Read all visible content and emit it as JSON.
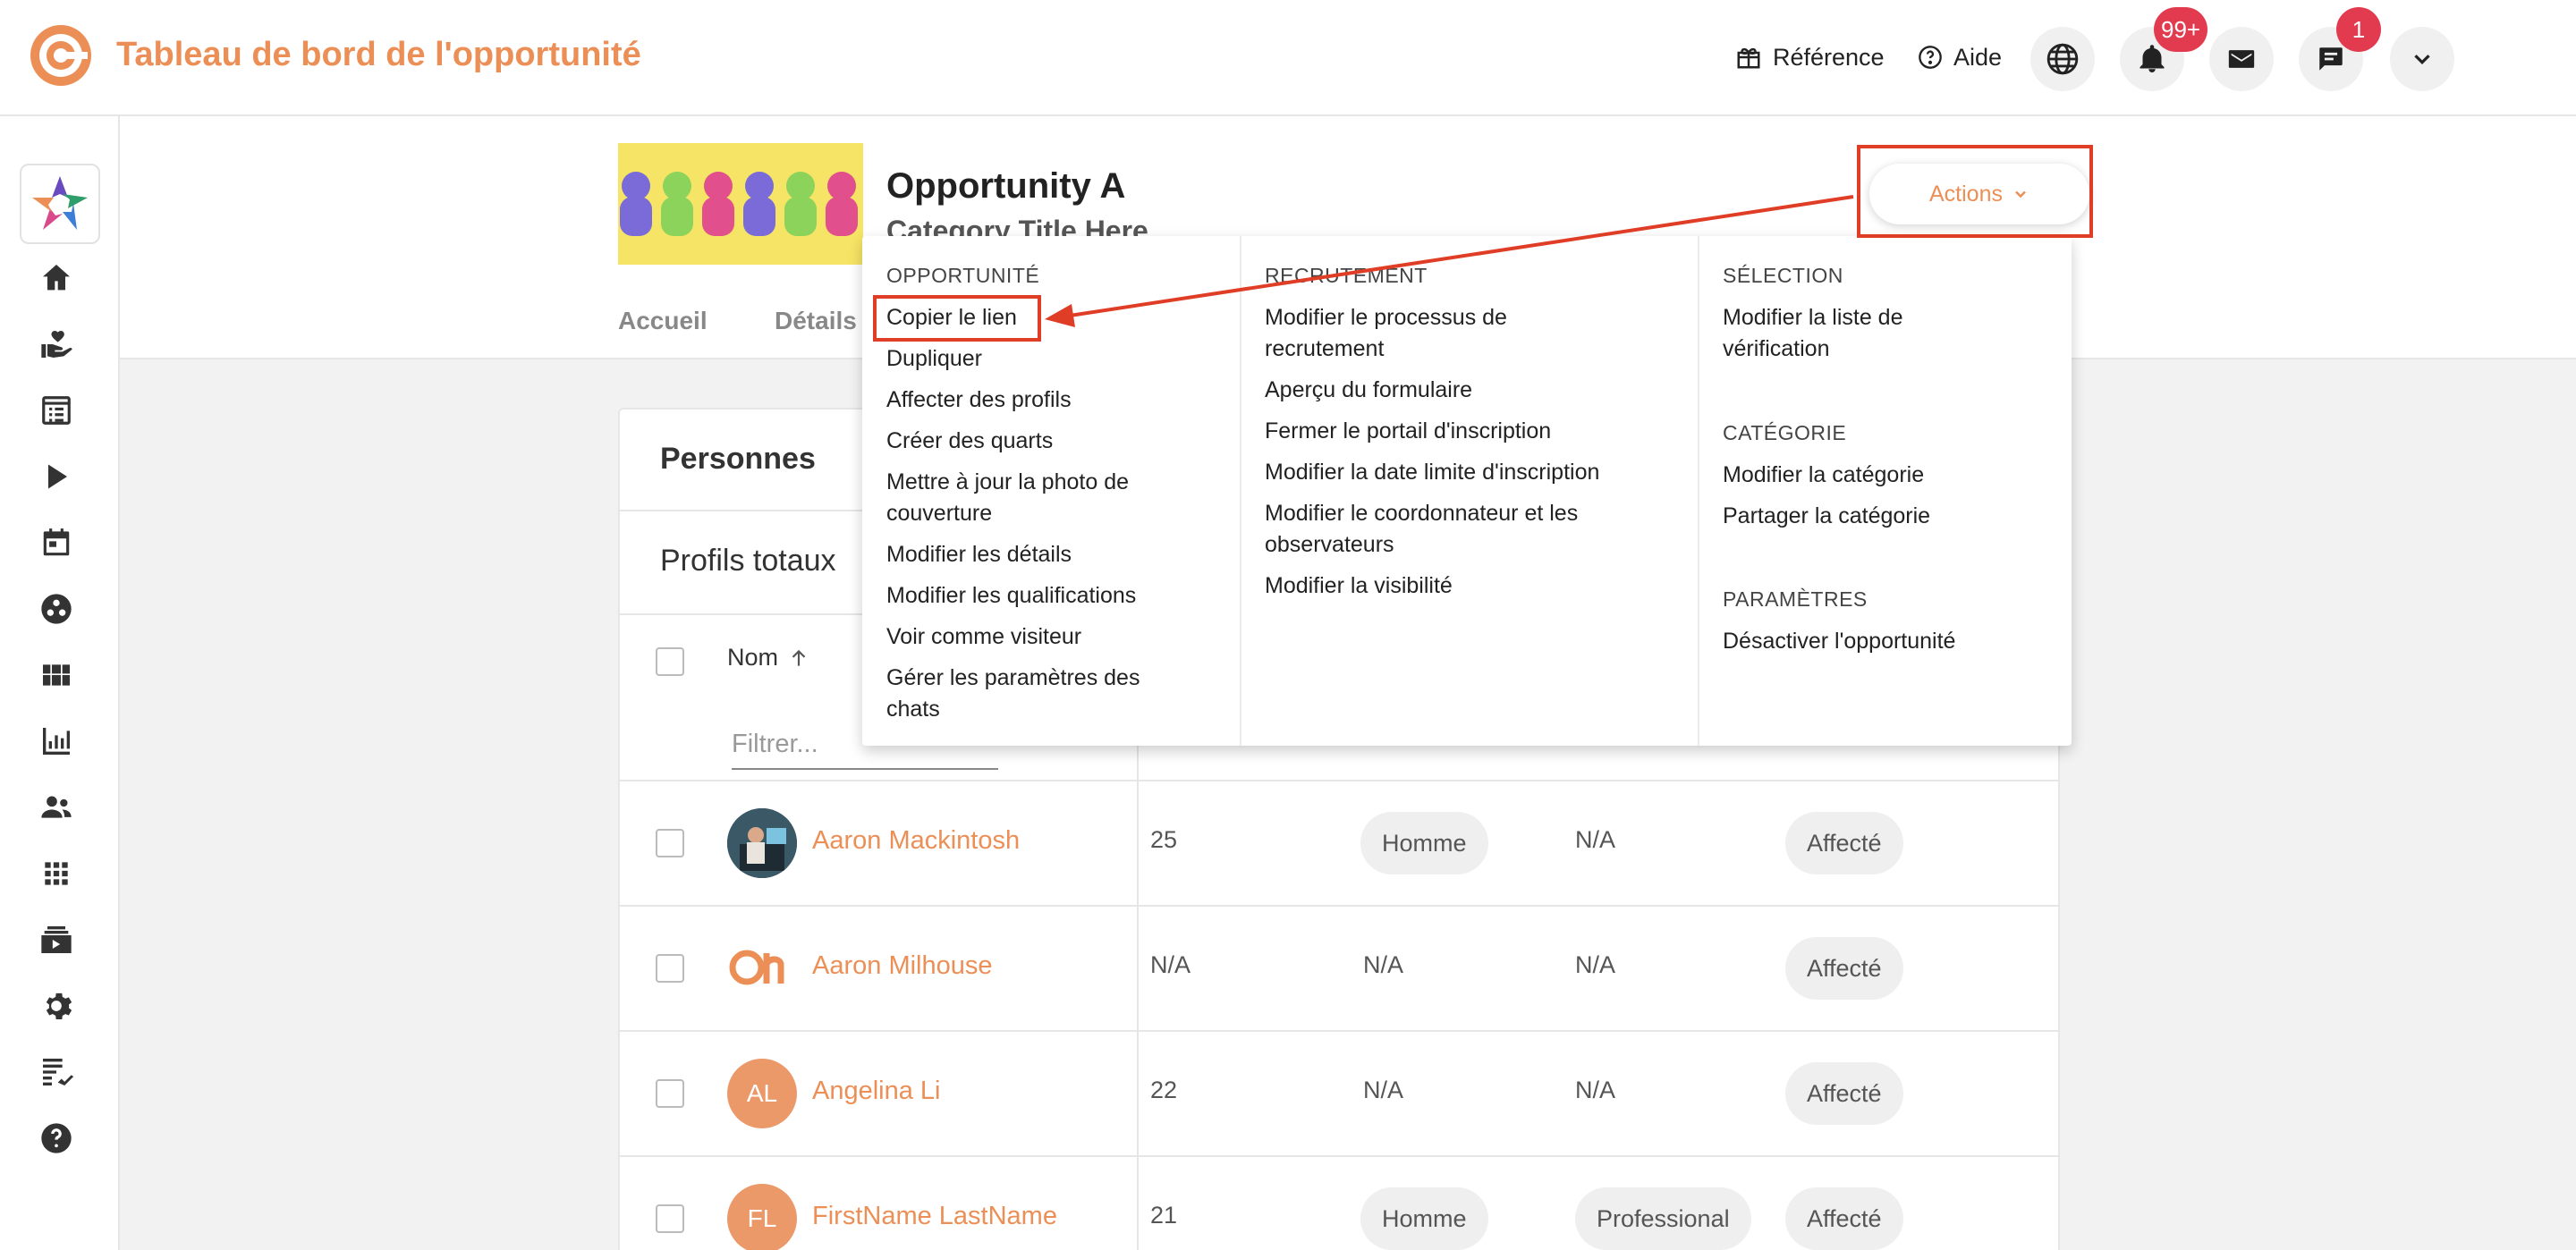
{
  "app": {
    "title": "Tableau de bord de l'opportunité"
  },
  "topbar": {
    "reference_label": "Référence",
    "help_label": "Aide",
    "notifications_badge": "99+",
    "chat_badge": "1"
  },
  "opportunity": {
    "title": "Opportunity A",
    "category": "Category Title Here",
    "tabs": [
      "Accueil",
      "Détails"
    ],
    "actions_label": "Actions"
  },
  "people_card": {
    "title": "Personnes",
    "total_label": "Profils totaux",
    "column_name": "Nom",
    "filter_placeholder": "Filtrer..."
  },
  "rows": [
    {
      "name": "Aaron Mackintosh",
      "initials": "",
      "age": "25",
      "gender": "Homme",
      "type": "N/A",
      "status": "Affecté"
    },
    {
      "name": "Aaron Milhouse",
      "initials": "",
      "age": "N/A",
      "gender": "N/A",
      "type": "N/A",
      "status": "Affecté"
    },
    {
      "name": "Angelina Li",
      "initials": "AL",
      "age": "22",
      "gender": "N/A",
      "type": "N/A",
      "status": "Affecté"
    },
    {
      "name": "FirstName LastName",
      "initials": "FL",
      "age": "21",
      "gender": "Homme",
      "type": "Professional",
      "status": "Affecté"
    }
  ],
  "actions_menu": {
    "sections": [
      {
        "heading": "OPPORTUNITÉ",
        "items": [
          "Copier le lien",
          "Dupliquer",
          "Affecter des profils",
          "Créer des quarts",
          "Mettre à jour la photo de couverture",
          "Modifier les détails",
          "Modifier les qualifications",
          "Voir comme visiteur",
          "Gérer les paramètres des chats"
        ]
      },
      {
        "heading": "RECRUTEMENT",
        "items": [
          "Modifier le processus de recrutement",
          "Aperçu du formulaire",
          "Fermer le portail d'inscription",
          "Modifier la date limite d'inscription",
          "Modifier le coordonnateur et les observateurs",
          "Modifier la visibilité"
        ]
      },
      {
        "heading": "SÉLECTION",
        "items": [
          "Modifier la liste de vérification"
        ]
      },
      {
        "heading": "CATÉGORIE",
        "items": [
          "Modifier la catégorie",
          "Partager la catégorie"
        ]
      },
      {
        "heading": "PARAMÈTRES",
        "items": [
          "Désactiver l'opportunité"
        ]
      }
    ]
  },
  "colors": {
    "accent": "#ec8f56",
    "annotation": "#e03d26",
    "badge": "#e23b4f"
  }
}
